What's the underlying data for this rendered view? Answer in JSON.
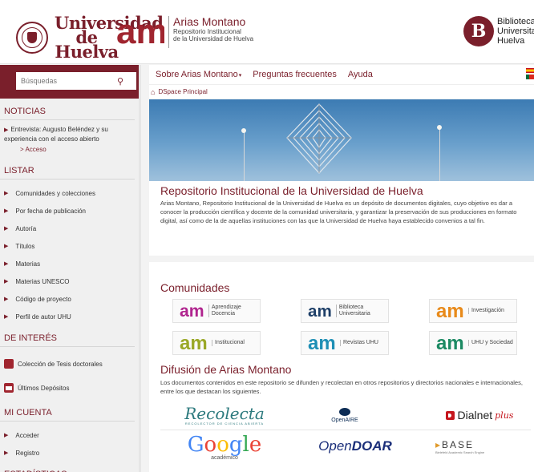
{
  "header": {
    "university_name": "Universidad de Huelva",
    "am_mark": "am",
    "repo_title": "Arias Montano",
    "repo_subtitle_1": "Repositorio Institucional",
    "repo_subtitle_2": "de la Universidad de Huelva",
    "library_lines": [
      "Biblioteca",
      "Universitaria",
      "Huelva"
    ]
  },
  "sidebar": {
    "search_placeholder": "Búsquedas",
    "news_title": "NOTICIAS",
    "news_item": "Entrevista: Augusto Beléndez y su experiencia con el acceso abierto",
    "news_link": "> Acceso",
    "list_title": "LISTAR",
    "list_items": [
      "Comunidades y colecciones",
      "Por fecha de publicación",
      "Autoría",
      "Títulos",
      "Materias",
      "Materias UNESCO",
      "Código de proyecto",
      "Perfil de autor UHU"
    ],
    "interest_title": "DE INTERÉS",
    "interest_items": [
      "Colección de Tesis doctorales",
      "Últimos Depósitos"
    ],
    "account_title": "MI CUENTA",
    "account_items": [
      "Acceder",
      "Registro"
    ],
    "stats_title": "ESTADÍSTICAS"
  },
  "topnav": {
    "about": "Sobre Arias Montano",
    "faq": "Preguntas frecuentes",
    "help": "Ayuda"
  },
  "breadcrumb": "DSpace Principal",
  "intro": {
    "title": "Repositorio Institucional de la Universidad de Huelva",
    "text": "Arias Montano, Repositorio Institucional de la Universidad de Huelva es un depósito de documentos digitales, cuyo objetivo es dar a conocer la producción científica y docente de la comunidad universitaria, y garantizar la preservación de sus producciones en formato digital, así como de la de aquellas instituciones con las que la Universidad de Huelva haya establecido convenios a tal fin."
  },
  "communities": {
    "title": "Comunidades",
    "items": [
      {
        "label": "Aprendizaje Docencia",
        "color": "#b0248e"
      },
      {
        "label": "Biblioteca Universitaria",
        "color": "#1e3f68"
      },
      {
        "label": "Investigación",
        "color": "#e88a1a"
      },
      {
        "label": "Institucional",
        "color": "#9aa826"
      },
      {
        "label": "Revistas UHU",
        "color": "#1e8fb5"
      },
      {
        "label": "UHU y Sociedad",
        "color": "#1c8a63"
      }
    ]
  },
  "diffusion": {
    "title": "Difusión de Arias Montano",
    "text": "Los documentos contenidos en este repositorio se difunden y recolectan en otros repositorios y directorios nacionales e internacionales, entre los que destacan los siguientes.",
    "repos": {
      "recolecta": "Recolecta",
      "recolecta_sub": "RECOLECTOR DE CIENCIA ABIERTA",
      "openaire": "OpenAIRE",
      "dialnet": "Dialnet",
      "dialnet_plus": "plus",
      "google": "Google",
      "google_sub": "académico",
      "opendoar_a": "Open",
      "opendoar_b": "DOAR",
      "base": "BASE",
      "base_sub": "Bielefeld Academic Search Engine"
    }
  },
  "colors": {
    "brand": "#7a1f2b",
    "accent": "#a0252f"
  }
}
